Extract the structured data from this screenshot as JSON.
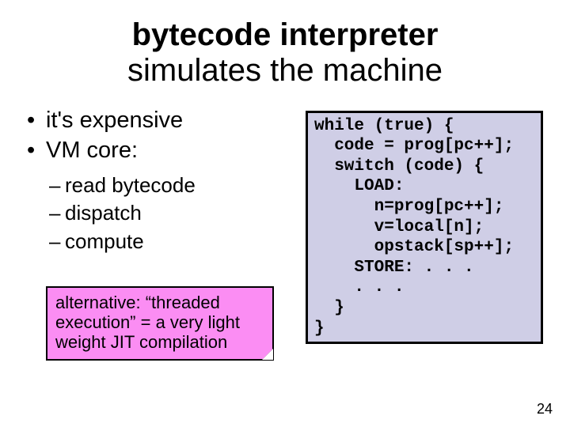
{
  "title": {
    "line1": "bytecode interpreter",
    "line2": "simulates the machine"
  },
  "bullets": [
    "it's expensive",
    "VM core:"
  ],
  "sub": [
    "read bytecode",
    "dispatch",
    "compute"
  ],
  "note": "alternative: “threaded execution” = a very light weight JIT compilation",
  "code": "while (true) {\n  code = prog[pc++];\n  switch (code) {\n    LOAD:\n      n=prog[pc++];\n      v=local[n];\n      opstack[sp++];\n    STORE: . . .\n    . . .\n  }\n}",
  "page": "24"
}
